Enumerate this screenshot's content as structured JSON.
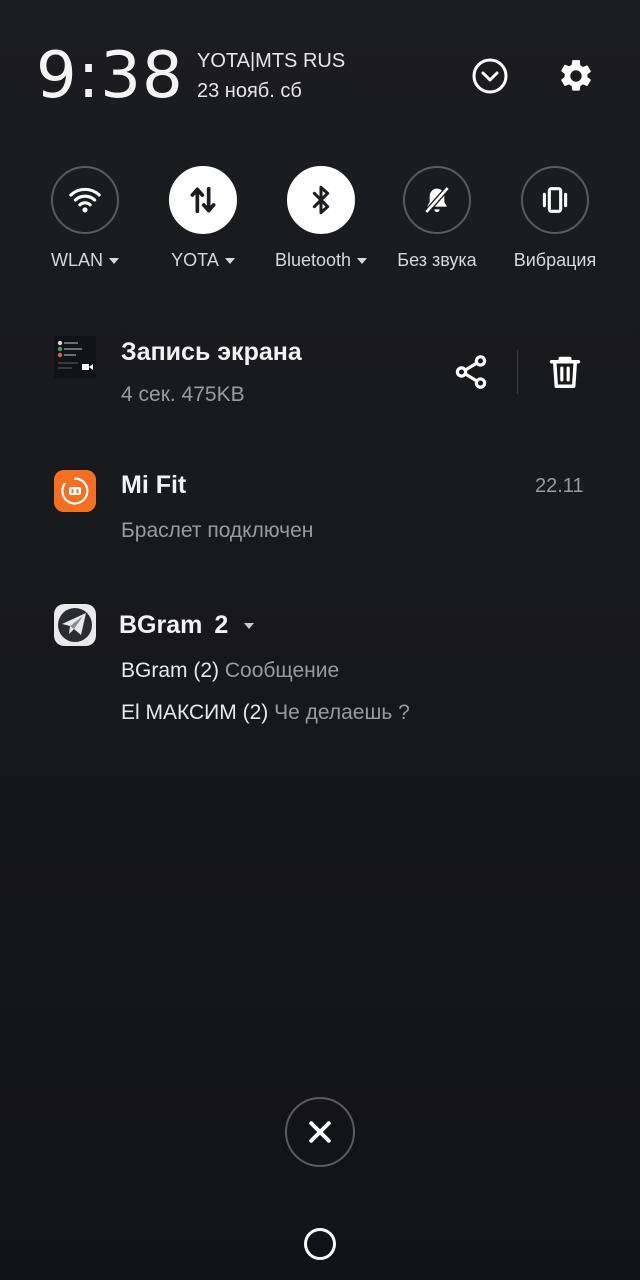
{
  "status": {
    "time": "9:38",
    "carrier": "YOTA|MTS RUS",
    "date": "23 нояб. сб"
  },
  "header": {
    "expand_icon": "chevron-down-circle-icon",
    "settings_icon": "gear-icon"
  },
  "toggles": [
    {
      "label": "WLAN",
      "icon": "wifi-icon",
      "active": false,
      "has_menu": true
    },
    {
      "label": "YOTA",
      "icon": "mobile-data-icon",
      "active": true,
      "has_menu": true
    },
    {
      "label": "Bluetooth",
      "icon": "bluetooth-icon",
      "active": true,
      "has_menu": true
    },
    {
      "label": "Без звука",
      "icon": "bell-off-icon",
      "active": false,
      "has_menu": false
    },
    {
      "label": "Вибрация",
      "icon": "vibrate-icon",
      "active": false,
      "has_menu": false
    }
  ],
  "notifications": {
    "screen_record": {
      "title": "Запись экрана",
      "meta": "4 сек.  475KB",
      "actions": [
        "share-icon",
        "trash-icon"
      ]
    },
    "mifit": {
      "app": "Mi Fit",
      "time": "22.11",
      "text": "Браслет подключен",
      "icon_color": "#f36f21"
    },
    "bgram": {
      "app": "BGram",
      "count": "2",
      "lines": [
        {
          "sender": "BGram (2)",
          "message": "Сообщение"
        },
        {
          "sender": "El МАКСИМ (2)",
          "message": "Че делаешь ?"
        }
      ]
    }
  },
  "colors": {
    "background": "#1c1d20",
    "primary_text": "#f2f2f2",
    "secondary_text": "#9a9b9f",
    "toggle_on": "#ffffff",
    "toggle_off_border": "#5a5b5f"
  }
}
